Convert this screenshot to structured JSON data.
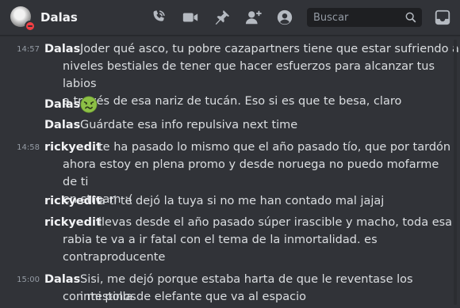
{
  "header": {
    "title": "Dalas",
    "search_placeholder": "Buscar",
    "icons": [
      "phone-call-icon",
      "video-icon",
      "pin-icon",
      "add-member-icon",
      "profile-icon",
      "search-icon",
      "inbox-icon"
    ]
  },
  "colors": {
    "background": "#313338",
    "status_dnd": "#f23f43",
    "text": "#dbdee1",
    "muted": "#949ba4"
  },
  "messages": [
    {
      "timestamp": "14:57",
      "author": "Dalas",
      "lines": [
        "Joder qué asco, tu pobre cazapartners tiene que estar sufriendo a",
        "niveles bestiales de tener que hacer esfuerzos para alcanzar tus labios",
        "a través de esa nariz de tucán. Eso si es que te besa, claro"
      ]
    },
    {
      "timestamp": "",
      "author": "Dalas",
      "emoji": "nauseated-face"
    },
    {
      "timestamp": "",
      "author": "Dalas",
      "lines": [
        "Guárdate esa info repulsiva next time"
      ]
    },
    {
      "timestamp": "14:58",
      "author": "rickyedit",
      "lines": [
        "te ha pasado lo mismo que el año pasado tío, que por tardón",
        "ahora estoy en plena promo y desde noruega no puedo mofarme de ti",
        "en stream :("
      ]
    },
    {
      "timestamp": "",
      "author": "rickyedit",
      "lines": [
        "a ti te dejó la tuya si no me han contado mal jajaj"
      ]
    },
    {
      "timestamp": "",
      "author": "rickyedit",
      "lines": [
        "llevas desde el año pasado súper irascible y macho, toda esa",
        "rabia te va a ir fatal con el tema de la inmortalidad. es",
        "contraproducente"
      ]
    },
    {
      "timestamp": "15:00",
      "author": "Dalas",
      "lines": [
        "Sisi, me dejó porque estaba harta de que le reventase los intestinos",
        "con mi polla de elefante que va al espacio"
      ]
    }
  ]
}
